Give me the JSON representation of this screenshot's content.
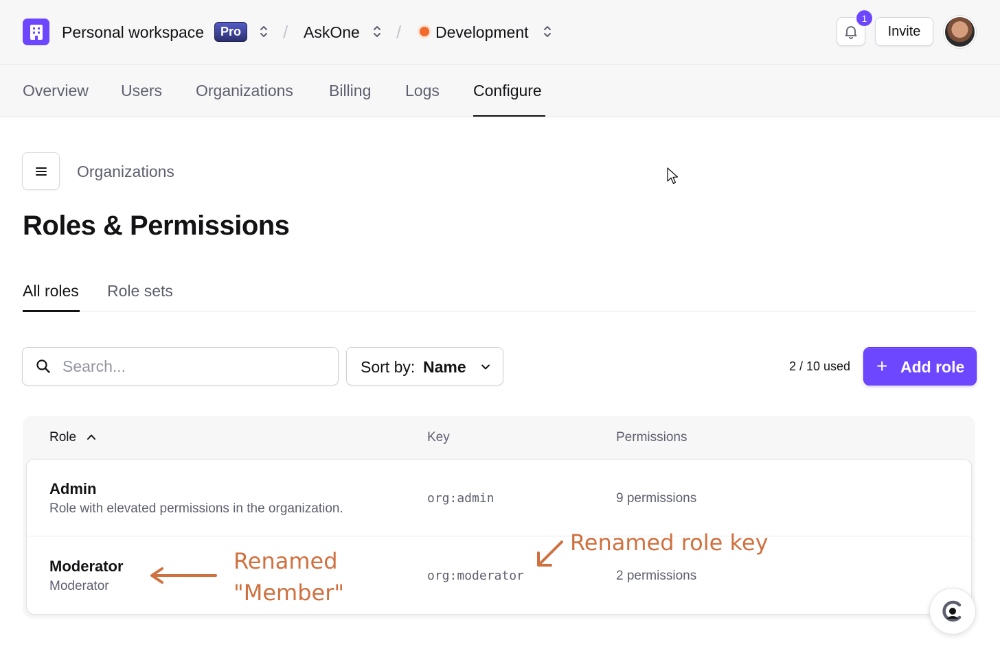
{
  "header": {
    "workspace": "Personal workspace",
    "plan_badge": "Pro",
    "app": "AskOne",
    "environment": "Development",
    "notification_count": "1",
    "invite_label": "Invite",
    "env_dot_color": "#f36b2c",
    "accent_color": "#6c47ff"
  },
  "nav": {
    "tabs": [
      "Overview",
      "Users",
      "Organizations",
      "Billing",
      "Logs",
      "Configure"
    ],
    "active": "Configure"
  },
  "page": {
    "section": "Organizations",
    "title": "Roles & Permissions",
    "subtabs": [
      "All roles",
      "Role sets"
    ],
    "active_subtab": "All roles"
  },
  "toolbar": {
    "search_placeholder": "Search...",
    "sort_label": "Sort by:",
    "sort_value": "Name",
    "usage": "2 / 10 used",
    "add_role_label": "Add role"
  },
  "table": {
    "headers": {
      "role": "Role",
      "key": "Key",
      "permissions": "Permissions"
    },
    "rows": [
      {
        "name": "Admin",
        "description": "Role with elevated permissions in the organization.",
        "key": "org:admin",
        "permissions": "9 permissions"
      },
      {
        "name": "Moderator",
        "description": "Moderator",
        "key": "org:moderator",
        "permissions": "2 permissions"
      }
    ]
  },
  "annotations": {
    "renamed_member_line1": "Renamed",
    "renamed_member_line2": "\"Member\"",
    "renamed_key": "Renamed role key",
    "color": "#d0703f"
  }
}
